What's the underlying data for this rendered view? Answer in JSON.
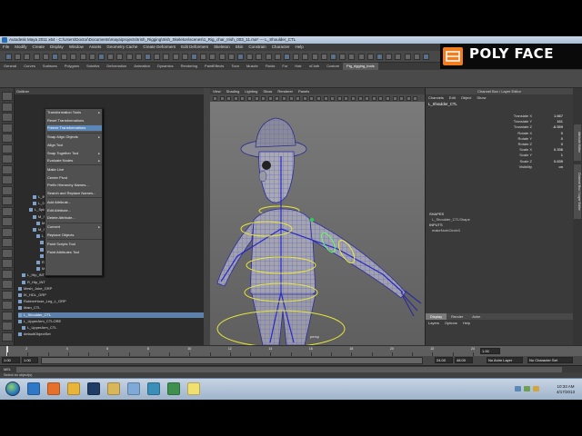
{
  "window": {
    "title": "Autodesk Maya 2011 x64 - C:\\Users\\Doctor\\Documents\\maya\\projects\\Irish_Rigging\\Irish_Skeleton\\scenes\\1_Rig_char_Irish_003_11.ma* --- L_Shoulder_CTL"
  },
  "overlay_logo": {
    "text": "POLY FACE",
    "color": "#f07d1e"
  },
  "menubar": {
    "items": [
      "File",
      "Modify",
      "Create",
      "Display",
      "Window",
      "Assets",
      "Geometry Cache",
      "Create Deformers",
      "Edit Deformers",
      "Skeleton",
      "Skin",
      "Constrain",
      "Character",
      "Help"
    ]
  },
  "shelf_tabs": {
    "items": [
      "General",
      "Curves",
      "Surfaces",
      "Polygons",
      "Subdivs",
      "Deformation",
      "Animation",
      "Dynamics",
      "Rendering",
      "PaintEffects",
      "Toon",
      "Muscle",
      "Fluids",
      "Fur",
      "Hair",
      "nCloth",
      "Custom",
      "Pig_rigging_tools"
    ],
    "active_index": 17
  },
  "context_menu": {
    "items": [
      "Transformation Tools",
      "Reset Transformations",
      "Freeze Transformations",
      "Snap Align Objects",
      "Align Tool",
      "Snap Together Tool",
      "Evaluate Nodes",
      "Make Live",
      "Center Pivot",
      "Prefix Hierarchy Names...",
      "Search and Replace Names...",
      "Add Attribute...",
      "Edit Attribute...",
      "Delete Attribute...",
      "Convert",
      "Replace Objects",
      "Paint Scripts Tool",
      "Paint Attributes Tool"
    ],
    "highlight_index": 2,
    "submenu_indices": [
      0,
      3,
      5,
      6,
      14
    ]
  },
  "outliner": {
    "header": "Outliner",
    "items": [
      {
        "label": "L_INT",
        "indent": 20
      },
      {
        "label": "L_01_INT",
        "indent": 20
      },
      {
        "label": "L_Spine_07_INT",
        "indent": 16
      },
      {
        "label": "M_Spine_08_INT",
        "indent": 20
      },
      {
        "label": "M_Neck_INT",
        "indent": 24
      },
      {
        "label": "M_Spine_09_INT",
        "indent": 20
      },
      {
        "label": "L_Shoulder_INT",
        "indent": 24
      },
      {
        "label": "L_Armbase_INT",
        "indent": 28
      },
      {
        "label": "L_PR_Armbase_INT",
        "indent": 28
      },
      {
        "label": "L_IK_Armbase_INT",
        "indent": 28
      },
      {
        "label": "R_Shoulder_INT",
        "indent": 24
      },
      {
        "label": "M_Spine_09_INT_parentConstraint1",
        "indent": 24
      },
      {
        "label": "L_Hip_INT",
        "indent": 8
      },
      {
        "label": "R_Hip_INT",
        "indent": 8
      },
      {
        "label": "Mesh_Joke_GRP",
        "indent": 4
      },
      {
        "label": "IK_HDL_GRP",
        "indent": 4
      },
      {
        "label": "RubberHose_Leg_L_GRP",
        "indent": 4
      },
      {
        "label": "Main_CTL",
        "indent": 4
      },
      {
        "label": "L_Shoulder_CTL",
        "indent": 4,
        "selected": true
      },
      {
        "label": "L_UpperArm_CTLORE",
        "indent": 4
      },
      {
        "label": "L_UpperArm_CTL",
        "indent": 8
      },
      {
        "label": "defaultObjectSet",
        "indent": 4
      }
    ]
  },
  "viewport": {
    "menu": [
      "View",
      "Shading",
      "Lighting",
      "Show",
      "Renderer",
      "Panels"
    ],
    "camera_label": "persp"
  },
  "channel_box": {
    "title": "Channel Box / Layer Editor",
    "tabs": [
      "Channels",
      "Edit",
      "Object",
      "Show"
    ],
    "object": "L_Shoulder_CTL",
    "attributes": [
      {
        "name": "Translate X",
        "value": "1.667"
      },
      {
        "name": "Translate Y",
        "value": "161"
      },
      {
        "name": "Translate Z",
        "value": "-6.559"
      },
      {
        "name": "Rotate X",
        "value": "0"
      },
      {
        "name": "Rotate Y",
        "value": "0"
      },
      {
        "name": "Rotate Z",
        "value": "0"
      },
      {
        "name": "Scale X",
        "value": "0.336"
      },
      {
        "name": "Scale Y",
        "value": "1"
      },
      {
        "name": "Scale Z",
        "value": "0.639"
      },
      {
        "name": "Visibility",
        "value": "on"
      }
    ],
    "shapes_header": "SHAPES",
    "shape_name": "L_Shoulder_CTLShape",
    "inputs_header": "INPUTS",
    "input_name": "makeNurbCircle3"
  },
  "layer_editor": {
    "tabs": [
      "Display",
      "Render",
      "Anim"
    ],
    "active_tab": 0,
    "menu": [
      "Layers",
      "Options",
      "Help"
    ]
  },
  "side_tabs": [
    "Attribute Editor",
    "Channel Box / Layer Editor"
  ],
  "timeline": {
    "start": 1,
    "end": 24,
    "ticks": [
      2,
      4,
      6,
      8,
      10,
      12,
      14,
      16,
      18,
      20,
      22,
      24
    ],
    "current_frame_value": "1.00"
  },
  "range_bar": {
    "start_field": "1.00",
    "inner_start": "1.00",
    "inner_end": "24.00",
    "end_field": "24.00",
    "anim_end": "48.00",
    "anim_layer": "No Anim Layer",
    "char_set": "No Character Set"
  },
  "command_line": {
    "label": "MEL"
  },
  "help_line": {
    "text": "Select an object(s)"
  },
  "taskbar": {
    "clock_time": "10:33 AM",
    "clock_date": "4/17/2013",
    "icons": [
      {
        "name": "ie-icon",
        "color": "#2f78c8"
      },
      {
        "name": "firefox-icon",
        "color": "#e6702a"
      },
      {
        "name": "media-icon",
        "color": "#e8b43a"
      },
      {
        "name": "photoshop-icon",
        "color": "#1f3c66"
      },
      {
        "name": "explorer-icon",
        "color": "#d8b65a"
      },
      {
        "name": "paint-icon",
        "color": "#7fa9d6"
      },
      {
        "name": "maya-icon",
        "color": "#3a8fb8"
      },
      {
        "name": "camtasia-icon",
        "color": "#3f8f4f"
      },
      {
        "name": "notes-icon",
        "color": "#f0e070"
      }
    ]
  }
}
